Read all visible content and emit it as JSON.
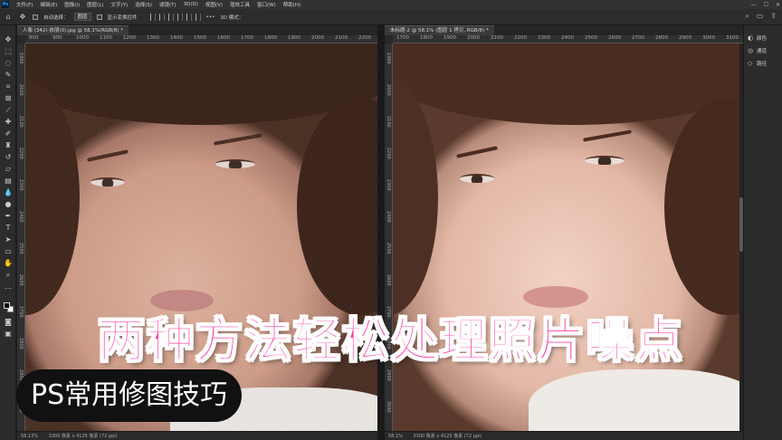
{
  "app": {
    "logo": "Ps"
  },
  "menu": [
    "文件(F)",
    "编辑(E)",
    "图像(I)",
    "图层(L)",
    "文字(Y)",
    "选择(S)",
    "滤镜(T)",
    "3D(D)",
    "视图(V)",
    "增效工具",
    "窗口(W)",
    "帮助(H)"
  ],
  "window_controls": [
    "—",
    "☐",
    "✕"
  ],
  "options": {
    "auto_select_label": "自动选择：",
    "auto_select_value": "图层",
    "show_transform_label": "显示变换控件",
    "more_label": "•••",
    "mode_3d_label": "3D 模式："
  },
  "docs": [
    {
      "tab": "人像 (342)-依朋(0).jpg @ 58.1%(RGB/8) *",
      "ruler_h": [
        "800",
        "900",
        "1000",
        "1100",
        "1200",
        "1300",
        "1400",
        "1500",
        "1600",
        "1700",
        "1800",
        "1900",
        "2000",
        "2100",
        "2200"
      ],
      "ruler_v": [
        "1900",
        "2000",
        "2100",
        "2200",
        "2300",
        "2400",
        "2500",
        "2600",
        "2700",
        "2800",
        "2900",
        "3000"
      ],
      "zoom": "58.13%",
      "doc_info": "3300 像素 x 4125 像素 (72 ppi)"
    },
    {
      "tab": "未标题-2 @ 58.1% (图层 1 拷贝, RGB/8) *",
      "ruler_h": [
        "1700",
        "1800",
        "1900",
        "2000",
        "2100",
        "2200",
        "2300",
        "2400",
        "2500",
        "2600",
        "2700",
        "2800",
        "2900",
        "3000",
        "3100"
      ],
      "ruler_v": [
        "1900",
        "2000",
        "2100",
        "2200",
        "2300",
        "2400",
        "2500",
        "2600",
        "2700",
        "2800",
        "2900",
        "3000"
      ],
      "zoom": "58.1%",
      "doc_info": "3300 像素 x 4125 像素 (72 ppi)"
    }
  ],
  "panels": [
    {
      "label": "颜色",
      "icon": "color-icon"
    },
    {
      "label": "通道",
      "icon": "channels-icon"
    },
    {
      "label": "路径",
      "icon": "paths-icon"
    }
  ],
  "overlay": {
    "headline": "两种方法轻松处理照片噪点",
    "badge": "PS常用修图技巧"
  },
  "colors": {
    "headline": "#ff3aa0",
    "badge_bg": "#111111",
    "ui_bg": "#2c2c2c"
  }
}
